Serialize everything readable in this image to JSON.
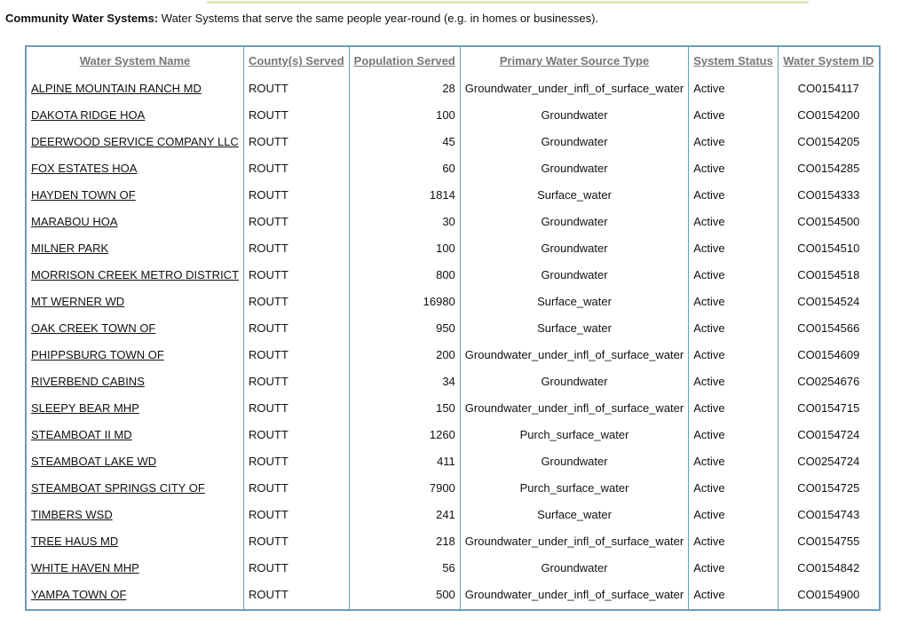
{
  "intro": {
    "label": "Community Water Systems:",
    "text": " Water Systems that serve the same people year-round (e.g. in homes or businesses)."
  },
  "table": {
    "headers": [
      "Water System Name",
      "County(s) Served",
      "Population Served",
      "Primary Water Source Type",
      "System Status",
      "Water System ID"
    ],
    "rows": [
      {
        "name": "ALPINE MOUNTAIN RANCH MD",
        "county": "ROUTT",
        "population": "28",
        "source": "Groundwater_under_infl_of_surface_water",
        "status": "Active",
        "id": "CO0154117"
      },
      {
        "name": "DAKOTA RIDGE HOA",
        "county": "ROUTT",
        "population": "100",
        "source": "Groundwater",
        "status": "Active",
        "id": "CO0154200"
      },
      {
        "name": "DEERWOOD SERVICE COMPANY LLC",
        "county": "ROUTT",
        "population": "45",
        "source": "Groundwater",
        "status": "Active",
        "id": "CO0154205"
      },
      {
        "name": "FOX ESTATES HOA",
        "county": "ROUTT",
        "population": "60",
        "source": "Groundwater",
        "status": "Active",
        "id": "CO0154285"
      },
      {
        "name": "HAYDEN TOWN OF",
        "county": "ROUTT",
        "population": "1814",
        "source": "Surface_water",
        "status": "Active",
        "id": "CO0154333"
      },
      {
        "name": "MARABOU HOA",
        "county": "ROUTT",
        "population": "30",
        "source": "Groundwater",
        "status": "Active",
        "id": "CO0154500"
      },
      {
        "name": "MILNER PARK",
        "county": "ROUTT",
        "population": "100",
        "source": "Groundwater",
        "status": "Active",
        "id": "CO0154510"
      },
      {
        "name": "MORRISON CREEK METRO DISTRICT",
        "county": "ROUTT",
        "population": "800",
        "source": "Groundwater",
        "status": "Active",
        "id": "CO0154518"
      },
      {
        "name": "MT WERNER WD",
        "county": "ROUTT",
        "population": "16980",
        "source": "Surface_water",
        "status": "Active",
        "id": "CO0154524"
      },
      {
        "name": "OAK CREEK TOWN OF",
        "county": "ROUTT",
        "population": "950",
        "source": "Surface_water",
        "status": "Active",
        "id": "CO0154566"
      },
      {
        "name": "PHIPPSBURG TOWN OF",
        "county": "ROUTT",
        "population": "200",
        "source": "Groundwater_under_infl_of_surface_water",
        "status": "Active",
        "id": "CO0154609"
      },
      {
        "name": "RIVERBEND CABINS",
        "county": "ROUTT",
        "population": "34",
        "source": "Groundwater",
        "status": "Active",
        "id": "CO0254676"
      },
      {
        "name": "SLEEPY BEAR MHP",
        "county": "ROUTT",
        "population": "150",
        "source": "Groundwater_under_infl_of_surface_water",
        "status": "Active",
        "id": "CO0154715"
      },
      {
        "name": "STEAMBOAT II MD",
        "county": "ROUTT",
        "population": "1260",
        "source": "Purch_surface_water",
        "status": "Active",
        "id": "CO0154724"
      },
      {
        "name": "STEAMBOAT LAKE WD",
        "county": "ROUTT",
        "population": "411",
        "source": "Groundwater",
        "status": "Active",
        "id": "CO0254724"
      },
      {
        "name": "STEAMBOAT SPRINGS CITY OF",
        "county": "ROUTT",
        "population": "7900",
        "source": "Purch_surface_water",
        "status": "Active",
        "id": "CO0154725"
      },
      {
        "name": "TIMBERS WSD",
        "county": "ROUTT",
        "population": "241",
        "source": "Surface_water",
        "status": "Active",
        "id": "CO0154743"
      },
      {
        "name": "TREE HAUS MD",
        "county": "ROUTT",
        "population": "218",
        "source": "Groundwater_under_infl_of_surface_water",
        "status": "Active",
        "id": "CO0154755"
      },
      {
        "name": "WHITE HAVEN MHP",
        "county": "ROUTT",
        "population": "56",
        "source": "Groundwater",
        "status": "Active",
        "id": "CO0154842"
      },
      {
        "name": "YAMPA TOWN OF",
        "county": "ROUTT",
        "population": "500",
        "source": "Groundwater_under_infl_of_surface_water",
        "status": "Active",
        "id": "CO0154900"
      }
    ]
  }
}
